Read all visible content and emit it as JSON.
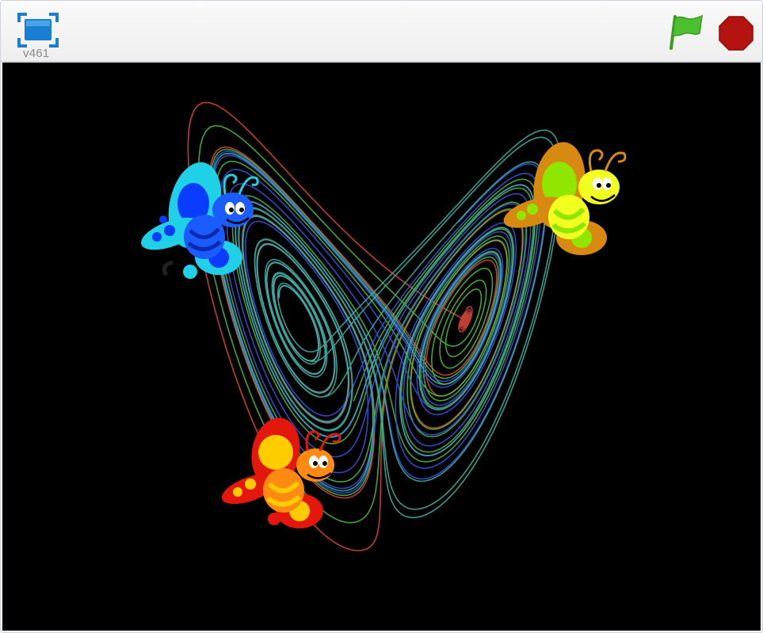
{
  "player": {
    "version_label": "v461",
    "buttons": {
      "fullscreen": "fullscreen-icon",
      "green_flag": "green-flag-icon",
      "stop": "stop-sign-icon"
    },
    "colors": {
      "flag": "#4cbf2f",
      "stop": "#b5130f",
      "fullscreen": "#1a7fd1",
      "stage_background": "#000000"
    }
  },
  "stage": {
    "trail_colors": [
      "#e0493a",
      "#4fbf3f",
      "#3a56e0",
      "#3fb5a5"
    ],
    "sprites": [
      {
        "name": "blue-butterfly-sprite",
        "wing": "#1fd0e6",
        "spot": "#0a3cff",
        "body": "#1a5cff"
      },
      {
        "name": "yellow-butterfly-sprite",
        "wing": "#d8890f",
        "spot": "#8fe600",
        "body": "#f2ff1e"
      },
      {
        "name": "red-butterfly-sprite",
        "wing": "#e4170c",
        "spot": "#ffcc00",
        "body": "#ff8a12"
      }
    ]
  }
}
